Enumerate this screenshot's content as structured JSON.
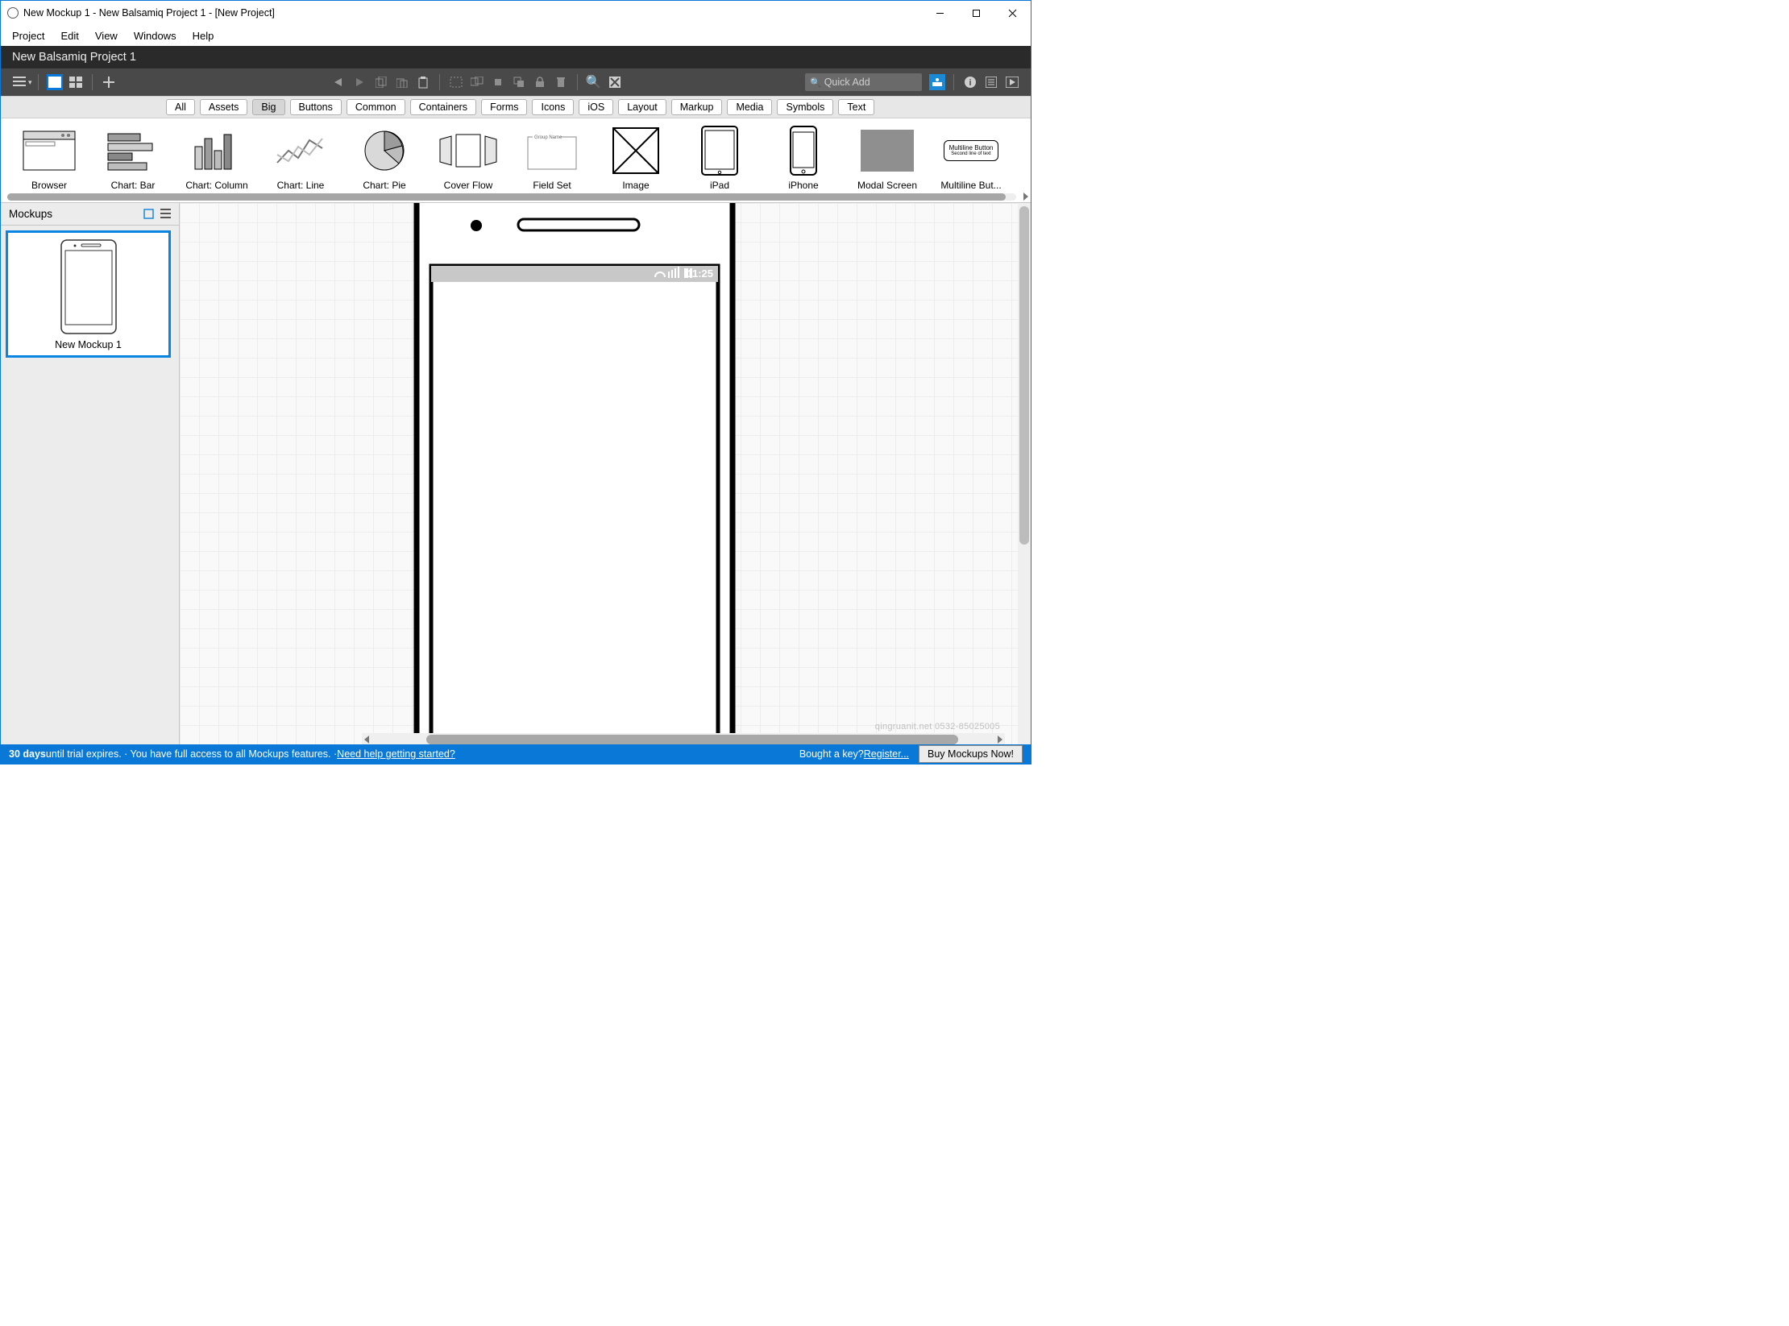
{
  "window": {
    "title": "New Mockup 1 - New Balsamiq Project 1 - [New Project]"
  },
  "menu": {
    "items": [
      "Project",
      "Edit",
      "View",
      "Windows",
      "Help"
    ]
  },
  "project_header": {
    "name": "New Balsamiq Project 1"
  },
  "toolbar": {
    "quickadd_placeholder": "Quick Add"
  },
  "filters": {
    "items": [
      "All",
      "Assets",
      "Big",
      "Buttons",
      "Common",
      "Containers",
      "Forms",
      "Icons",
      "iOS",
      "Layout",
      "Markup",
      "Media",
      "Symbols",
      "Text"
    ],
    "selected": "Big"
  },
  "library": {
    "items": [
      {
        "label": "Browser"
      },
      {
        "label": "Chart: Bar"
      },
      {
        "label": "Chart: Column"
      },
      {
        "label": "Chart: Line"
      },
      {
        "label": "Chart: Pie"
      },
      {
        "label": "Cover Flow"
      },
      {
        "label": "Field Set"
      },
      {
        "label": "Image"
      },
      {
        "label": "iPad"
      },
      {
        "label": "iPhone"
      },
      {
        "label": "Modal Screen"
      },
      {
        "label": "Multiline But..."
      }
    ],
    "multiline_preview": {
      "line1": "Multiline Button",
      "line2": "Second line of text"
    }
  },
  "sidebar": {
    "title": "Mockups",
    "cards": [
      {
        "label": "New Mockup 1"
      }
    ]
  },
  "canvas": {
    "phone_time": "11:25"
  },
  "watermark": {
    "text": "qingruanit.net 0532-85025005"
  },
  "status": {
    "days": "30 days",
    "rest": " until trial expires.  ·  You have full access to all Mockups features.  ·  ",
    "help_link": "Need help getting started?",
    "bought_text": "Bought a key? ",
    "register_link": "Register...",
    "buy_btn": "Buy Mockups Now!"
  }
}
